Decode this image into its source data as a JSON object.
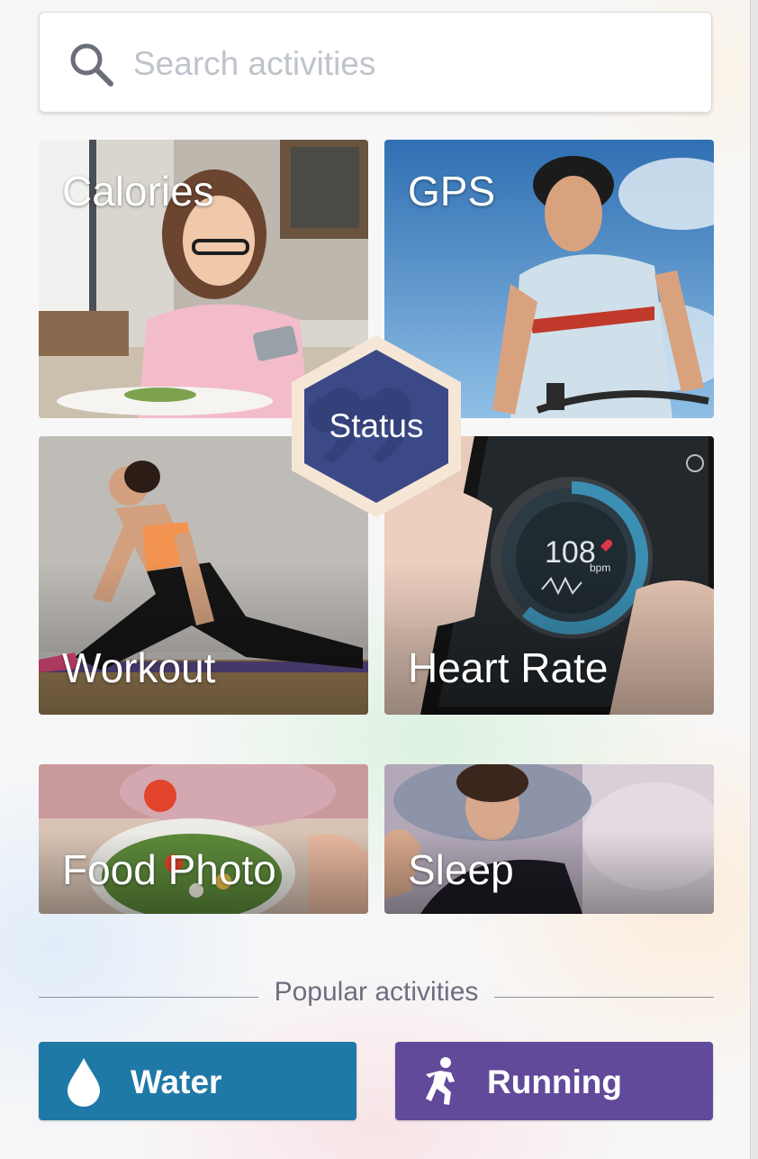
{
  "search": {
    "placeholder": "Search activities",
    "value": ""
  },
  "tiles": {
    "calories": {
      "label": "Calories"
    },
    "gps": {
      "label": "GPS"
    },
    "workout": {
      "label": "Workout"
    },
    "heart_rate": {
      "label": "Heart Rate",
      "screen_value": "108",
      "screen_unit": "bpm"
    },
    "food_photo": {
      "label": "Food Photo"
    },
    "sleep": {
      "label": "Sleep"
    }
  },
  "status": {
    "label": "Status"
  },
  "popular": {
    "heading": "Popular activities",
    "buttons": [
      {
        "label": "Water",
        "icon": "water-drop-icon",
        "color": "#1f79a6"
      },
      {
        "label": "Running",
        "icon": "running-person-icon",
        "color": "#614a9a"
      }
    ]
  },
  "colors": {
    "status_hex": "#3b4a86",
    "status_border": "#f6e6d6"
  }
}
